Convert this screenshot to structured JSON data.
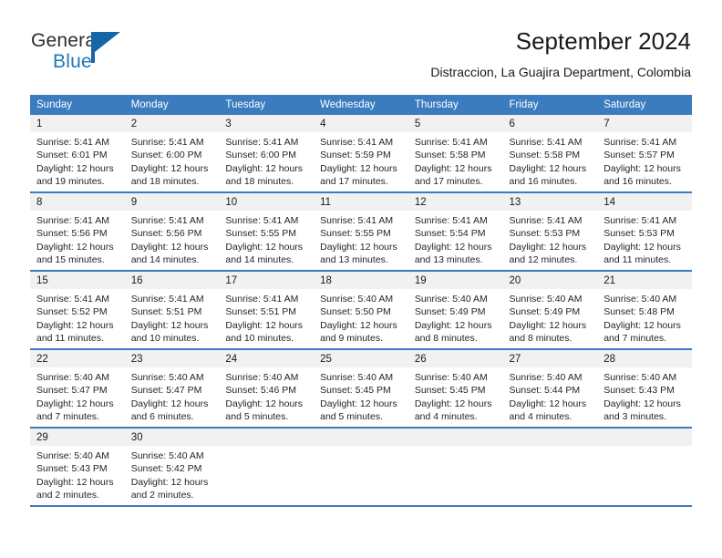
{
  "brand": {
    "word_one": "General",
    "word_two": "Blue",
    "mark_icon": "triangle-flag-icon",
    "accent_color": "#1f77b8"
  },
  "header": {
    "title": "September 2024",
    "subtitle": "Distraccion, La Guajira Department, Colombia"
  },
  "theme": {
    "header_blue": "#3a7cbe",
    "daynum_gray": "#f1f1f1",
    "text_dark": "#1a1a1a"
  },
  "weekdays": [
    "Sunday",
    "Monday",
    "Tuesday",
    "Wednesday",
    "Thursday",
    "Friday",
    "Saturday"
  ],
  "labels": {
    "sunrise_prefix": "Sunrise:",
    "sunset_prefix": "Sunset:",
    "daylight_prefix": "Daylight:"
  },
  "weeks": [
    [
      {
        "day": "1",
        "sunrise": "Sunrise: 5:41 AM",
        "sunset": "Sunset: 6:01 PM",
        "daylight_line1": "Daylight: 12 hours",
        "daylight_line2": "and 19 minutes."
      },
      {
        "day": "2",
        "sunrise": "Sunrise: 5:41 AM",
        "sunset": "Sunset: 6:00 PM",
        "daylight_line1": "Daylight: 12 hours",
        "daylight_line2": "and 18 minutes."
      },
      {
        "day": "3",
        "sunrise": "Sunrise: 5:41 AM",
        "sunset": "Sunset: 6:00 PM",
        "daylight_line1": "Daylight: 12 hours",
        "daylight_line2": "and 18 minutes."
      },
      {
        "day": "4",
        "sunrise": "Sunrise: 5:41 AM",
        "sunset": "Sunset: 5:59 PM",
        "daylight_line1": "Daylight: 12 hours",
        "daylight_line2": "and 17 minutes."
      },
      {
        "day": "5",
        "sunrise": "Sunrise: 5:41 AM",
        "sunset": "Sunset: 5:58 PM",
        "daylight_line1": "Daylight: 12 hours",
        "daylight_line2": "and 17 minutes."
      },
      {
        "day": "6",
        "sunrise": "Sunrise: 5:41 AM",
        "sunset": "Sunset: 5:58 PM",
        "daylight_line1": "Daylight: 12 hours",
        "daylight_line2": "and 16 minutes."
      },
      {
        "day": "7",
        "sunrise": "Sunrise: 5:41 AM",
        "sunset": "Sunset: 5:57 PM",
        "daylight_line1": "Daylight: 12 hours",
        "daylight_line2": "and 16 minutes."
      }
    ],
    [
      {
        "day": "8",
        "sunrise": "Sunrise: 5:41 AM",
        "sunset": "Sunset: 5:56 PM",
        "daylight_line1": "Daylight: 12 hours",
        "daylight_line2": "and 15 minutes."
      },
      {
        "day": "9",
        "sunrise": "Sunrise: 5:41 AM",
        "sunset": "Sunset: 5:56 PM",
        "daylight_line1": "Daylight: 12 hours",
        "daylight_line2": "and 14 minutes."
      },
      {
        "day": "10",
        "sunrise": "Sunrise: 5:41 AM",
        "sunset": "Sunset: 5:55 PM",
        "daylight_line1": "Daylight: 12 hours",
        "daylight_line2": "and 14 minutes."
      },
      {
        "day": "11",
        "sunrise": "Sunrise: 5:41 AM",
        "sunset": "Sunset: 5:55 PM",
        "daylight_line1": "Daylight: 12 hours",
        "daylight_line2": "and 13 minutes."
      },
      {
        "day": "12",
        "sunrise": "Sunrise: 5:41 AM",
        "sunset": "Sunset: 5:54 PM",
        "daylight_line1": "Daylight: 12 hours",
        "daylight_line2": "and 13 minutes."
      },
      {
        "day": "13",
        "sunrise": "Sunrise: 5:41 AM",
        "sunset": "Sunset: 5:53 PM",
        "daylight_line1": "Daylight: 12 hours",
        "daylight_line2": "and 12 minutes."
      },
      {
        "day": "14",
        "sunrise": "Sunrise: 5:41 AM",
        "sunset": "Sunset: 5:53 PM",
        "daylight_line1": "Daylight: 12 hours",
        "daylight_line2": "and 11 minutes."
      }
    ],
    [
      {
        "day": "15",
        "sunrise": "Sunrise: 5:41 AM",
        "sunset": "Sunset: 5:52 PM",
        "daylight_line1": "Daylight: 12 hours",
        "daylight_line2": "and 11 minutes."
      },
      {
        "day": "16",
        "sunrise": "Sunrise: 5:41 AM",
        "sunset": "Sunset: 5:51 PM",
        "daylight_line1": "Daylight: 12 hours",
        "daylight_line2": "and 10 minutes."
      },
      {
        "day": "17",
        "sunrise": "Sunrise: 5:41 AM",
        "sunset": "Sunset: 5:51 PM",
        "daylight_line1": "Daylight: 12 hours",
        "daylight_line2": "and 10 minutes."
      },
      {
        "day": "18",
        "sunrise": "Sunrise: 5:40 AM",
        "sunset": "Sunset: 5:50 PM",
        "daylight_line1": "Daylight: 12 hours",
        "daylight_line2": "and 9 minutes."
      },
      {
        "day": "19",
        "sunrise": "Sunrise: 5:40 AM",
        "sunset": "Sunset: 5:49 PM",
        "daylight_line1": "Daylight: 12 hours",
        "daylight_line2": "and 8 minutes."
      },
      {
        "day": "20",
        "sunrise": "Sunrise: 5:40 AM",
        "sunset": "Sunset: 5:49 PM",
        "daylight_line1": "Daylight: 12 hours",
        "daylight_line2": "and 8 minutes."
      },
      {
        "day": "21",
        "sunrise": "Sunrise: 5:40 AM",
        "sunset": "Sunset: 5:48 PM",
        "daylight_line1": "Daylight: 12 hours",
        "daylight_line2": "and 7 minutes."
      }
    ],
    [
      {
        "day": "22",
        "sunrise": "Sunrise: 5:40 AM",
        "sunset": "Sunset: 5:47 PM",
        "daylight_line1": "Daylight: 12 hours",
        "daylight_line2": "and 7 minutes."
      },
      {
        "day": "23",
        "sunrise": "Sunrise: 5:40 AM",
        "sunset": "Sunset: 5:47 PM",
        "daylight_line1": "Daylight: 12 hours",
        "daylight_line2": "and 6 minutes."
      },
      {
        "day": "24",
        "sunrise": "Sunrise: 5:40 AM",
        "sunset": "Sunset: 5:46 PM",
        "daylight_line1": "Daylight: 12 hours",
        "daylight_line2": "and 5 minutes."
      },
      {
        "day": "25",
        "sunrise": "Sunrise: 5:40 AM",
        "sunset": "Sunset: 5:45 PM",
        "daylight_line1": "Daylight: 12 hours",
        "daylight_line2": "and 5 minutes."
      },
      {
        "day": "26",
        "sunrise": "Sunrise: 5:40 AM",
        "sunset": "Sunset: 5:45 PM",
        "daylight_line1": "Daylight: 12 hours",
        "daylight_line2": "and 4 minutes."
      },
      {
        "day": "27",
        "sunrise": "Sunrise: 5:40 AM",
        "sunset": "Sunset: 5:44 PM",
        "daylight_line1": "Daylight: 12 hours",
        "daylight_line2": "and 4 minutes."
      },
      {
        "day": "28",
        "sunrise": "Sunrise: 5:40 AM",
        "sunset": "Sunset: 5:43 PM",
        "daylight_line1": "Daylight: 12 hours",
        "daylight_line2": "and 3 minutes."
      }
    ],
    [
      {
        "day": "29",
        "sunrise": "Sunrise: 5:40 AM",
        "sunset": "Sunset: 5:43 PM",
        "daylight_line1": "Daylight: 12 hours",
        "daylight_line2": "and 2 minutes."
      },
      {
        "day": "30",
        "sunrise": "Sunrise: 5:40 AM",
        "sunset": "Sunset: 5:42 PM",
        "daylight_line1": "Daylight: 12 hours",
        "daylight_line2": "and 2 minutes."
      },
      {
        "day": "",
        "sunrise": "",
        "sunset": "",
        "daylight_line1": "",
        "daylight_line2": ""
      },
      {
        "day": "",
        "sunrise": "",
        "sunset": "",
        "daylight_line1": "",
        "daylight_line2": ""
      },
      {
        "day": "",
        "sunrise": "",
        "sunset": "",
        "daylight_line1": "",
        "daylight_line2": ""
      },
      {
        "day": "",
        "sunrise": "",
        "sunset": "",
        "daylight_line1": "",
        "daylight_line2": ""
      },
      {
        "day": "",
        "sunrise": "",
        "sunset": "",
        "daylight_line1": "",
        "daylight_line2": ""
      }
    ]
  ]
}
